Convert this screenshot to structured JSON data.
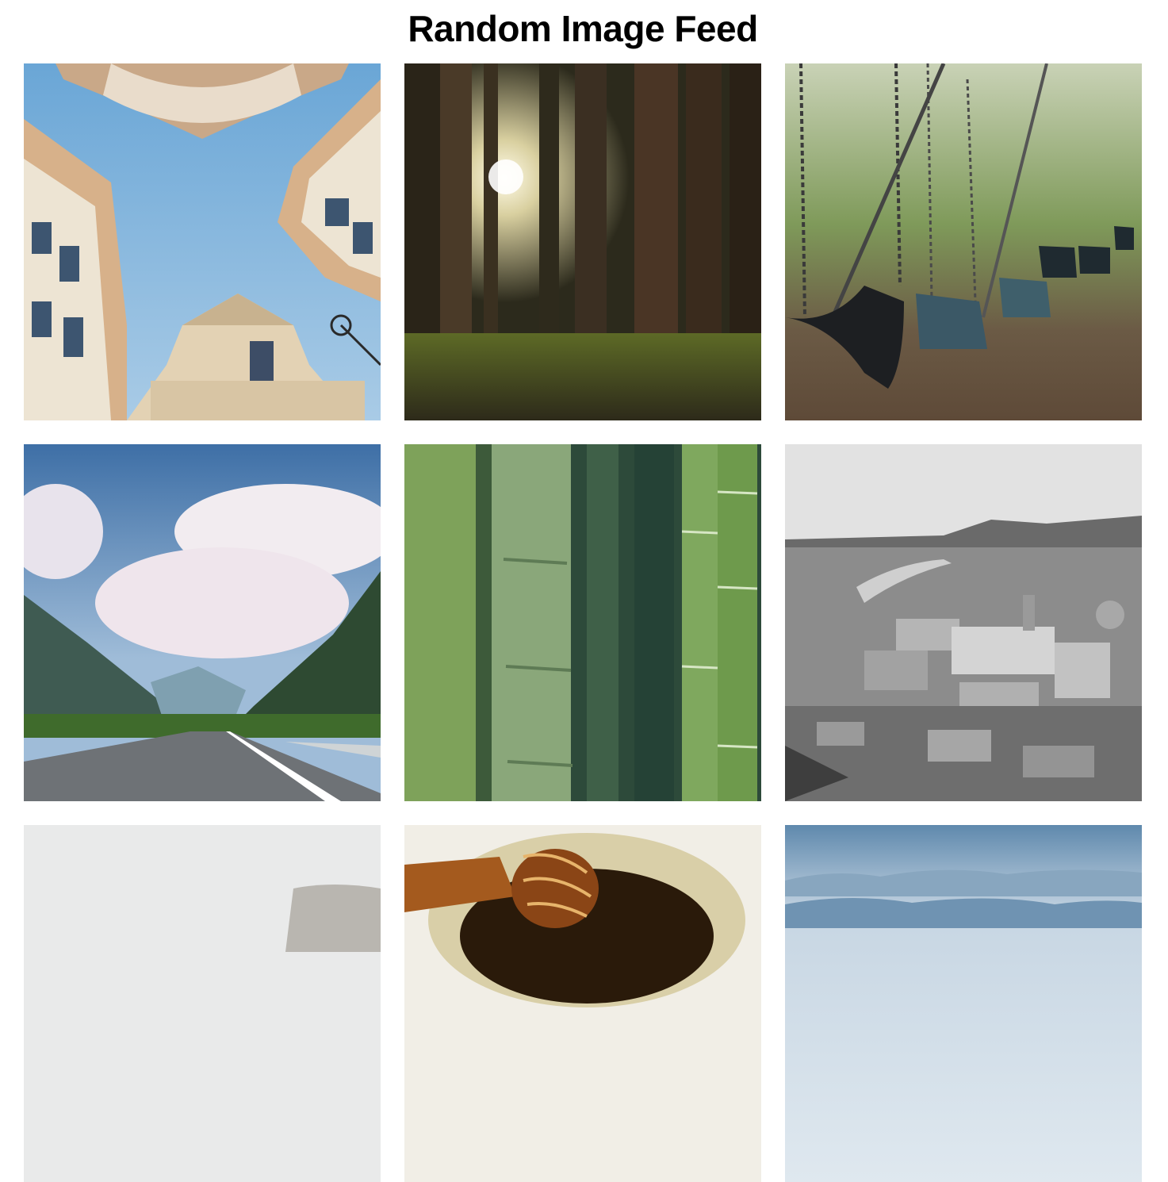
{
  "header": {
    "title": "Random Image Feed"
  },
  "feed": {
    "images": [
      {
        "subject": "baroque-buildings-looking-up"
      },
      {
        "subject": "sunlit-forest"
      },
      {
        "subject": "playground-swings"
      },
      {
        "subject": "mountain-highway"
      },
      {
        "subject": "bamboo-stalks"
      },
      {
        "subject": "black-and-white-city-view"
      },
      {
        "subject": "white-still-life"
      },
      {
        "subject": "honey-dipper"
      },
      {
        "subject": "misty-mountain-range"
      }
    ]
  }
}
